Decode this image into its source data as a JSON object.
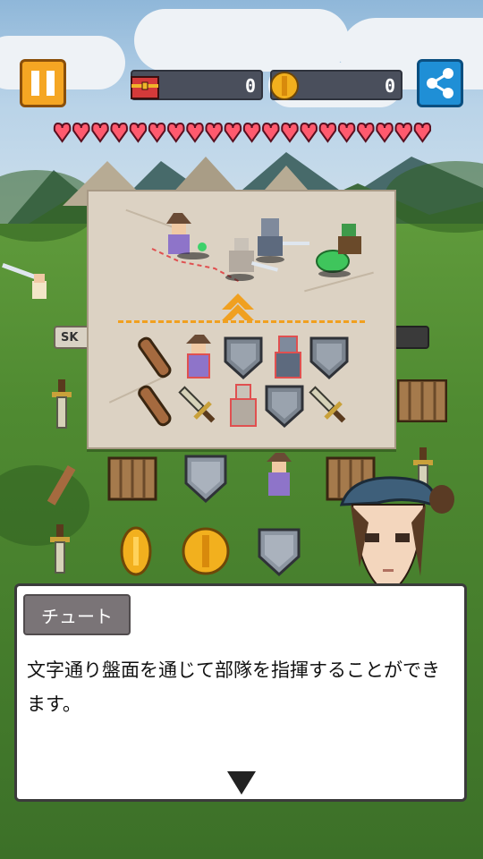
{
  "hud": {
    "treasure_count": "0",
    "coin_count": "0",
    "hearts_full": 20,
    "colors": {
      "pause": "#f5a623",
      "share": "#1f8fd6",
      "heart": "#ff5a6e"
    }
  },
  "side_label_left": "SK",
  "icons": {
    "pause": "pause-icon",
    "share": "share-icon",
    "treasure": "treasure-chest-icon",
    "coin": "coin-icon",
    "heart": "heart-icon",
    "up_arrow": "up-arrow-icon",
    "next": "down-triangle-icon"
  },
  "panel": {
    "enemies_row": [
      "mage-ally",
      "knight-ally",
      "swordsman-ally",
      "slime-enemy",
      "goblin-enemy"
    ],
    "board_rows": [
      [
        "club",
        "mage",
        "shield",
        "knight",
        "shield"
      ],
      [
        "club",
        "sword",
        "swordsman",
        "shield",
        "sword"
      ]
    ]
  },
  "field_rows": [
    [
      "crate",
      "shield",
      "mage",
      "crate"
    ],
    [
      "coin",
      "coin",
      "shield",
      "crate"
    ]
  ],
  "dialog": {
    "speaker": "チュート",
    "text": "文字通り盤面を通じて部隊を指揮することができます。"
  }
}
